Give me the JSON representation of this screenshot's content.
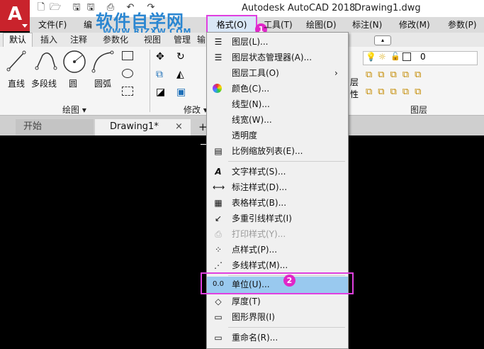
{
  "titlebar": {
    "app_title": "Autodesk AutoCAD 2018",
    "doc_title": "Drawing1.dwg",
    "logo_letter": "A",
    "quick_access": [
      "new-icon",
      "open-icon",
      "save-icon",
      "saveas-icon",
      "print-icon",
      "undo-icon",
      "redo-icon"
    ]
  },
  "watermark": {
    "line1": "软件自学网",
    "line2": "WWW.RJZXW.COM"
  },
  "menubar": {
    "items": [
      "文件(F)",
      "编",
      "格式(O)",
      "工具(T)",
      "绘图(D)",
      "标注(N)",
      "修改(M)",
      "参数(P)"
    ],
    "active": "格式(O)",
    "badge1": "1"
  },
  "ribbon_tabs": [
    "默认",
    "插入",
    "注释",
    "参数化",
    "视图",
    "管理",
    "输"
  ],
  "ribbon": {
    "draw_tools": [
      "直线",
      "多段线",
      "圆",
      "圆弧"
    ],
    "draw_panel": "绘图 ▾",
    "modify_panel": "修改 ▾",
    "layer_panel": "图层",
    "layer_name": "0",
    "side_label": "层\n性"
  },
  "file_tabs": {
    "start": "开始",
    "drawing": "Drawing1*",
    "close": "×",
    "add": "+"
  },
  "format_menu": {
    "items": [
      {
        "label": "图层(L)...",
        "icon": "layer-icon"
      },
      {
        "label": "图层状态管理器(A)...",
        "icon": "layer-state-icon"
      },
      {
        "label": "图层工具(O)",
        "icon": "",
        "submenu": "›"
      },
      {
        "label": "颜色(C)...",
        "icon": "color-wheel-icon"
      },
      {
        "label": "线型(N)...",
        "icon": ""
      },
      {
        "label": "线宽(W)...",
        "icon": ""
      },
      {
        "label": "透明度",
        "icon": ""
      },
      {
        "label": "比例缩放列表(E)...",
        "icon": "scale-list-icon"
      },
      {
        "label": "文字样式(S)...",
        "icon": "text-style-icon"
      },
      {
        "label": "标注样式(D)...",
        "icon": "dim-style-icon"
      },
      {
        "label": "表格样式(B)...",
        "icon": "table-style-icon"
      },
      {
        "label": "多重引线样式(I)",
        "icon": "mleader-style-icon"
      },
      {
        "label": "打印样式(Y)...",
        "icon": "plot-style-icon",
        "disabled": true
      },
      {
        "label": "点样式(P)...",
        "icon": "point-style-icon"
      },
      {
        "label": "多线样式(M)...",
        "icon": "mline-style-icon"
      },
      {
        "label": "单位(U)...",
        "icon": "units-icon",
        "highlight": true
      },
      {
        "label": "厚度(T)",
        "icon": "thickness-icon"
      },
      {
        "label": "图形界限(I)",
        "icon": "limits-icon"
      },
      {
        "label": "重命名(R)...",
        "icon": "rename-icon"
      }
    ],
    "badge2": "2"
  }
}
